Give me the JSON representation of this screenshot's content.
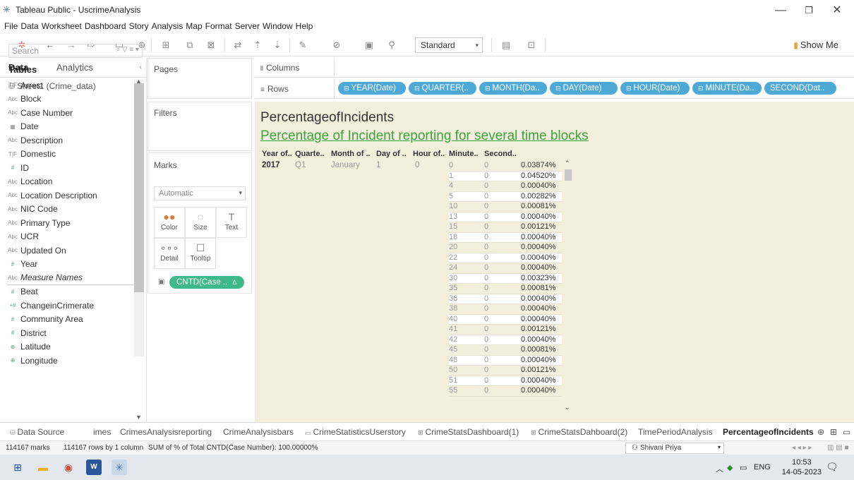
{
  "window": {
    "title": "Tableau Public - UscrimeAnalysis",
    "minimize": "—",
    "maximize": "❐",
    "close": "✕"
  },
  "menu": [
    "File",
    "Data",
    "Worksheet",
    "Dashboard",
    "Story",
    "Analysis",
    "Map",
    "Format",
    "Server",
    "Window",
    "Help"
  ],
  "toolbar": {
    "fit_mode": "Standard",
    "show_me": "Show Me"
  },
  "data_pane": {
    "tab_data": "Data",
    "tab_analytics": "Analytics",
    "datasource": "Sheet1 (Crime_data)",
    "search_placeholder": "Search",
    "tables_title": "Tables",
    "fields": [
      {
        "type": "T|F",
        "name": "Arrest"
      },
      {
        "type": "Abc",
        "name": "Block"
      },
      {
        "type": "Abc",
        "name": "Case Number"
      },
      {
        "type": "▦",
        "name": "Date"
      },
      {
        "type": "Abc",
        "name": "Description"
      },
      {
        "type": "T|F",
        "name": "Domestic"
      },
      {
        "type": "#",
        "name": "ID"
      },
      {
        "type": "Abc",
        "name": "Location"
      },
      {
        "type": "Abc",
        "name": "Location Description"
      },
      {
        "type": "Abc",
        "name": "NIC Code"
      },
      {
        "type": "Abc",
        "name": "Primary Type"
      },
      {
        "type": "Abc",
        "name": "UCR"
      },
      {
        "type": "Abc",
        "name": "Updated On"
      },
      {
        "type": "#",
        "name": "Year"
      },
      {
        "type": "Abc",
        "name": "Measure Names"
      },
      {
        "type": "#",
        "name": "Beat"
      },
      {
        "type": "+#",
        "name": "ChangeinCrimerate"
      },
      {
        "type": "#",
        "name": "Community Area"
      },
      {
        "type": "#",
        "name": "District"
      },
      {
        "type": "⊕",
        "name": "Latitude"
      },
      {
        "type": "⊕",
        "name": "Longitude"
      }
    ]
  },
  "cards": {
    "pages": "Pages",
    "filters": "Filters",
    "marks": "Marks",
    "mark_type": "Automatic",
    "mark_buttons": [
      {
        "icon": "●●",
        "label": "Color"
      },
      {
        "icon": "◌",
        "label": "Size"
      },
      {
        "icon": "T",
        "label": "Text"
      },
      {
        "icon": "∘∘∘",
        "label": "Detail"
      },
      {
        "icon": "☐",
        "label": "Tooltip"
      }
    ],
    "marks_pill": "CNTD(Case ..",
    "marks_pill_delta": "Δ"
  },
  "shelves": {
    "columns_label": "Columns",
    "rows_label": "Rows",
    "rows_pills": [
      "YEAR(Date)",
      "QUARTER(..",
      "MONTH(Da..",
      "DAY(Date)",
      "HOUR(Date)",
      "MINUTE(Da..",
      "SECOND(Dat.."
    ]
  },
  "viz": {
    "title": "PercentageofIncidents",
    "subtitle": "Percentage of Incident reporting for several time blocks",
    "headers": [
      "Year of..",
      "Quarte..",
      "Month of ..",
      "Day of ..",
      "Hour of..",
      "Minute..",
      "Second.."
    ],
    "first_row": {
      "year": "2017",
      "quarter": "Q1",
      "month": "January",
      "day": "1",
      "hour": "0"
    },
    "rows": [
      {
        "minute": "0",
        "second": "0",
        "pct": "0.03874%"
      },
      {
        "minute": "1",
        "second": "0",
        "pct": "0.04520%"
      },
      {
        "minute": "4",
        "second": "0",
        "pct": "0.00040%"
      },
      {
        "minute": "5",
        "second": "0",
        "pct": "0.00282%"
      },
      {
        "minute": "10",
        "second": "0",
        "pct": "0.00081%"
      },
      {
        "minute": "13",
        "second": "0",
        "pct": "0.00040%"
      },
      {
        "minute": "15",
        "second": "0",
        "pct": "0.00121%"
      },
      {
        "minute": "18",
        "second": "0",
        "pct": "0.00040%"
      },
      {
        "minute": "20",
        "second": "0",
        "pct": "0.00040%"
      },
      {
        "minute": "22",
        "second": "0",
        "pct": "0.00040%"
      },
      {
        "minute": "24",
        "second": "0",
        "pct": "0.00040%"
      },
      {
        "minute": "30",
        "second": "0",
        "pct": "0.00323%"
      },
      {
        "minute": "35",
        "second": "0",
        "pct": "0.00081%"
      },
      {
        "minute": "36",
        "second": "0",
        "pct": "0.00040%"
      },
      {
        "minute": "38",
        "second": "0",
        "pct": "0.00040%"
      },
      {
        "minute": "40",
        "second": "0",
        "pct": "0.00040%"
      },
      {
        "minute": "41",
        "second": "0",
        "pct": "0.00121%"
      },
      {
        "minute": "42",
        "second": "0",
        "pct": "0.00040%"
      },
      {
        "minute": "45",
        "second": "0",
        "pct": "0.00081%"
      },
      {
        "minute": "48",
        "second": "0",
        "pct": "0.00040%"
      },
      {
        "minute": "50",
        "second": "0",
        "pct": "0.00121%"
      },
      {
        "minute": "51",
        "second": "0",
        "pct": "0.00040%"
      },
      {
        "minute": "55",
        "second": "0",
        "pct": "0.00040%"
      }
    ]
  },
  "sheet_tabs": [
    {
      "label": "Data Source",
      "icon": "⛁",
      "active": false
    },
    {
      "label": "imes",
      "icon": "",
      "active": false
    },
    {
      "label": "CrimesAnalysisreporting",
      "icon": "",
      "active": false
    },
    {
      "label": "CrimeAnalysisbars",
      "icon": "",
      "active": false
    },
    {
      "label": "CrimeStatisticsUserstory",
      "icon": "▭",
      "active": false
    },
    {
      "label": "CrimeStatsDashboard(1)",
      "icon": "⊞",
      "active": false
    },
    {
      "label": "CrimeStatsDahboard(2)",
      "icon": "⊞",
      "active": false
    },
    {
      "label": "TimePeriodAnalysis",
      "icon": "",
      "active": false
    },
    {
      "label": "PercentageofIncidents",
      "icon": "",
      "active": true
    }
  ],
  "status": {
    "marks": "114167 marks",
    "rows": "114167 rows by 1 column",
    "sum": "SUM of % of Total CNTD(Case Number): 100.00000%",
    "user": "Shivani Priya"
  },
  "taskbar": {
    "lang": "ENG",
    "time": "10:53",
    "date": "14-05-2023"
  },
  "colors": {
    "green_pill": "#3fb98a",
    "blue_pill": "#4fa9d6",
    "viz_bg": "#f4eedd",
    "subtitle_green": "#3aa33a"
  }
}
